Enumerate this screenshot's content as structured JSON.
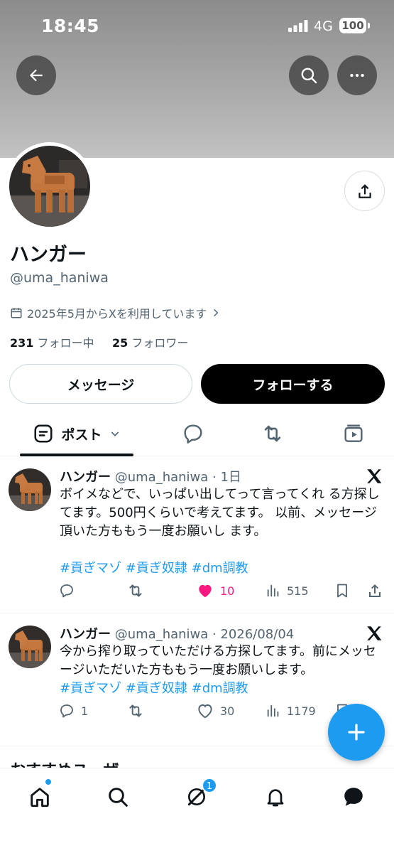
{
  "status_bar": {
    "time": "18:45",
    "network": "4G",
    "battery": "100"
  },
  "profile": {
    "name": "ハンガー",
    "handle": "@uma_haniwa",
    "joined": "2025年5月からXを利用しています",
    "following_count": "231",
    "following_label": "フォロー中",
    "followers_count": "25",
    "followers_label": "フォロワー"
  },
  "actions": {
    "message_label": "メッセージ",
    "follow_label": "フォローする"
  },
  "tabs": {
    "posts_label": "ポスト"
  },
  "tweets": [
    {
      "name": "ハンガー",
      "meta": "@uma_haniwa · 1日",
      "text": "ボイメなどで、いっぱい出してって言ってくれ る方探してます。500円くらいで考えてます。 以前、メッセージ頂いた方ももう一度お願いし ます。",
      "tags": "#貢ぎマゾ #貢ぎ奴隷 #dm調教",
      "replies": "",
      "likes": "10",
      "views": "515"
    },
    {
      "name": "ハンガー",
      "meta": "@uma_haniwa · 2026/08/04",
      "text": "今から搾り取っていただける方探してます。前にメッセージいただいた方ももう一度お願いします。",
      "tags": "#貢ぎマゾ #貢ぎ奴隷 #dm調教",
      "replies": "1",
      "likes": "30",
      "views": "1179"
    }
  ],
  "recommended_label": "おすすめユーザー",
  "nav": {
    "messages_badge": "1"
  },
  "colors": {
    "accent": "#1d9bf0",
    "like": "#f91880",
    "text": "#0f1419",
    "muted": "#536471"
  },
  "icons": [
    "back-arrow-icon",
    "search-icon",
    "more-icon",
    "share-icon",
    "calendar-icon",
    "chevron-right-icon",
    "posts-tab-icon",
    "chevron-down-icon",
    "replies-tab-icon",
    "reposts-tab-icon",
    "media-tab-icon",
    "x-logo-icon",
    "reply-icon",
    "retweet-icon",
    "heart-icon",
    "views-icon",
    "bookmark-icon",
    "plus-icon",
    "home-icon",
    "explore-icon",
    "grok-icon",
    "notifications-icon",
    "messages-icon"
  ]
}
